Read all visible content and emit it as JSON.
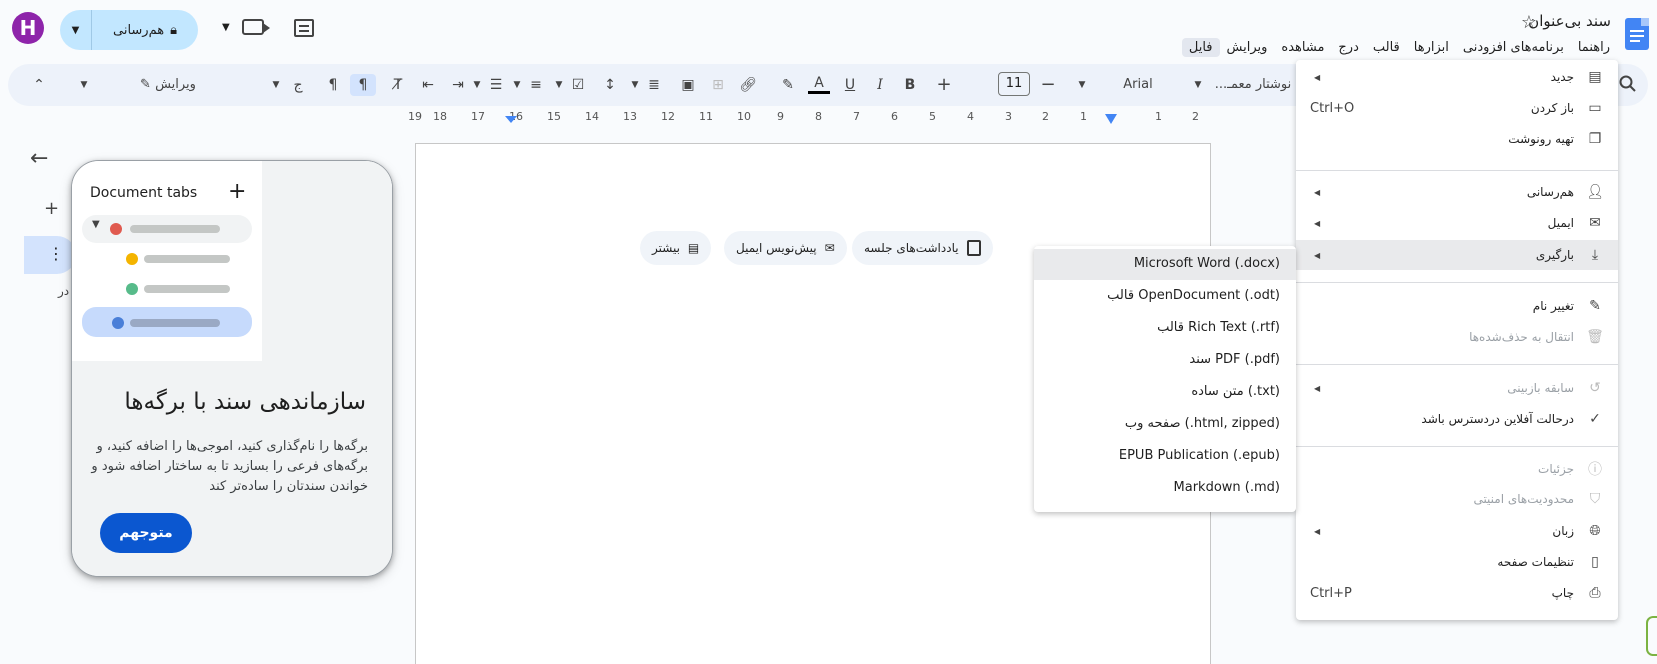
{
  "header": {
    "doc_title": "سند بی‌عنوان",
    "avatar_letter": "H",
    "share_label": "هم‌رسانی"
  },
  "menubar": [
    "فایل",
    "ویرایش",
    "مشاهده",
    "درج",
    "قالب",
    "ابزارها",
    "برنامه‌های افزودنی",
    "راهنما"
  ],
  "toolbar": {
    "font_name": "Arial",
    "style_name": "نوشتار معمـ...",
    "font_size": "11",
    "mode_label": "ویرایش"
  },
  "ruler": {
    "right_numbers": [
      "2",
      "1",
      "",
      "1",
      "2",
      "3",
      "4",
      "5",
      "6",
      "7",
      "8",
      "9",
      "10",
      "11",
      "12",
      "13",
      "14",
      "15",
      "16",
      "17",
      "18",
      "19"
    ]
  },
  "left_panel": {
    "small_text": "در"
  },
  "tabs_card": {
    "title": "Document tabs",
    "heading": "سازماندهی سند با برگه‌ها",
    "body": "برگه‌ها را نام‌گذاری کنید، اموجی‌ها را اضافه کنید، و برگه‌های فرعی را بسازید تا به ساختار اضافه شود و خواندن سندتان را ساده‌تر کند",
    "ok_label": "متوجهم"
  },
  "page_chips": [
    {
      "label": "یادداشت‌های جلسه"
    },
    {
      "label": "پیش‌نویس ایمیل"
    },
    {
      "label": "بیشتر"
    }
  ],
  "file_menu": {
    "items": [
      {
        "label": "جدید",
        "icon": "new-doc-icon",
        "submenu": true
      },
      {
        "label": "باز کردن",
        "icon": "folder-icon",
        "shortcut": "Ctrl+O"
      },
      {
        "label": "تهیه رونوشت",
        "icon": "copy-icon"
      },
      {
        "label": "هم‌رسانی",
        "icon": "person-add-icon",
        "submenu": true
      },
      {
        "label": "ایمیل",
        "icon": "email-icon",
        "submenu": true
      },
      {
        "label": "بارگیری",
        "icon": "download-icon",
        "submenu": true
      },
      {
        "label": "تغییر نام",
        "icon": "pencil-icon"
      },
      {
        "label": "انتقال به حذف‌شده‌ها",
        "icon": "trash-icon"
      },
      {
        "label": "سابقه بازبینی",
        "icon": "history-icon",
        "submenu": true
      },
      {
        "label": "درحالت آفلاین دردسترس باشد",
        "icon": "offline-check-icon"
      },
      {
        "label": "جزئیات",
        "icon": "info-icon"
      },
      {
        "label": "محدودیت‌های امنیتی",
        "icon": "shield-icon"
      },
      {
        "label": "زبان",
        "icon": "globe-icon",
        "submenu": true
      },
      {
        "label": "تنظیمات صفحه",
        "icon": "page-setup-icon"
      },
      {
        "label": "چاپ",
        "icon": "print-icon",
        "shortcut": "Ctrl+P"
      }
    ]
  },
  "download_menu": {
    "items": [
      "Microsoft Word (.docx)",
      "قالب OpenDocument (.odt)",
      "قالب Rich Text (.rtf)",
      "سند PDF (.pdf)",
      "متن ساده (.txt)",
      "صفحه وب (.html, zipped)",
      "EPUB Publication (.epub)",
      "Markdown (.md)"
    ]
  }
}
